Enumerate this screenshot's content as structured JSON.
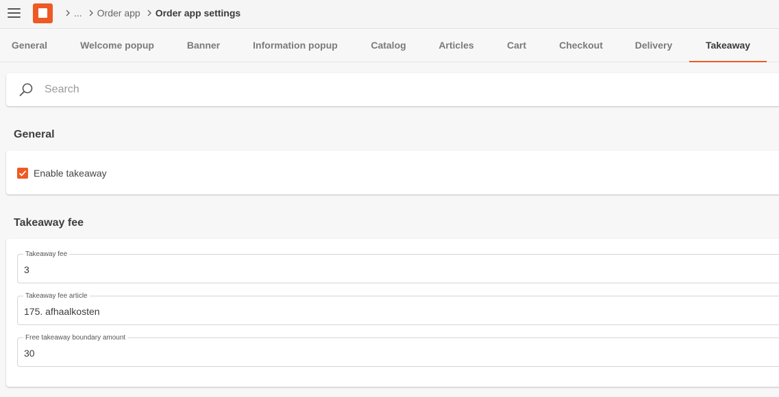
{
  "header": {
    "menu_icon": "hamburger-menu-icon",
    "logo_icon": "app-logo-icon",
    "brand_color": "#ee5a24",
    "breadcrumb": {
      "ellipsis": "...",
      "parent": "Order app",
      "current": "Order app settings"
    }
  },
  "tabs": [
    {
      "label": "General"
    },
    {
      "label": "Welcome popup"
    },
    {
      "label": "Banner"
    },
    {
      "label": "Information popup"
    },
    {
      "label": "Catalog"
    },
    {
      "label": "Articles"
    },
    {
      "label": "Cart"
    },
    {
      "label": "Checkout"
    },
    {
      "label": "Delivery"
    },
    {
      "label": "Takeaway"
    }
  ],
  "active_tab": "Takeaway",
  "search": {
    "icon": "search-icon",
    "placeholder": "Search",
    "value": ""
  },
  "sections": {
    "general": {
      "title": "General",
      "enable_takeaway": {
        "label": "Enable takeaway",
        "checked": true
      }
    },
    "takeaway_fee": {
      "title": "Takeaway fee",
      "fields": [
        {
          "label": "Takeaway fee",
          "value": "3"
        },
        {
          "label": "Takeaway fee article",
          "value": "175. afhaalkosten"
        },
        {
          "label": "Free takeaway boundary amount",
          "value": "30"
        }
      ]
    }
  }
}
